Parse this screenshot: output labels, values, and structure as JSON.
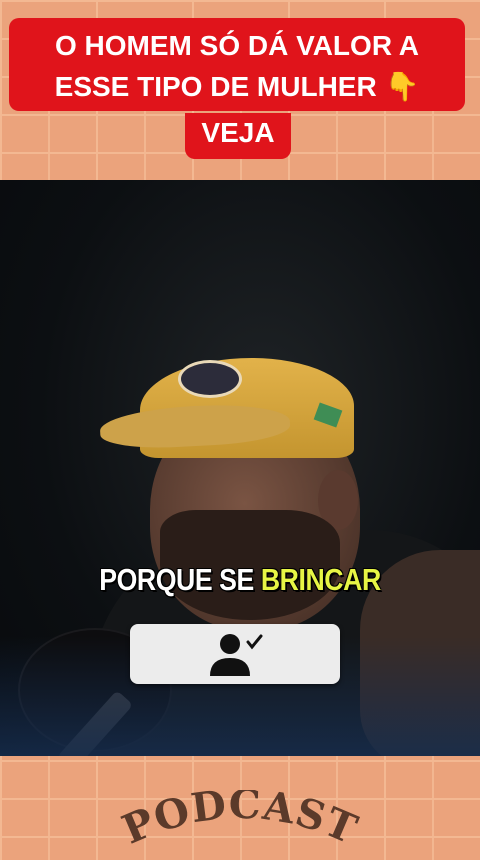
{
  "headline": {
    "line1": "O HOMEM SÓ DÁ VALOR A",
    "line2_text": "ESSE TIPO DE MULHER",
    "line2_emoji": "👇",
    "line3": "VEJA"
  },
  "caption": {
    "white": "PORQUE SE",
    "yellow": "BRINCAR"
  },
  "follow_button": {
    "icon": "user-check-icon"
  },
  "footer": {
    "brand": "PODCAST"
  },
  "colors": {
    "headline_bg": "#e0141b",
    "caption_yellow": "#e7f545",
    "brick": "#eba37c"
  }
}
